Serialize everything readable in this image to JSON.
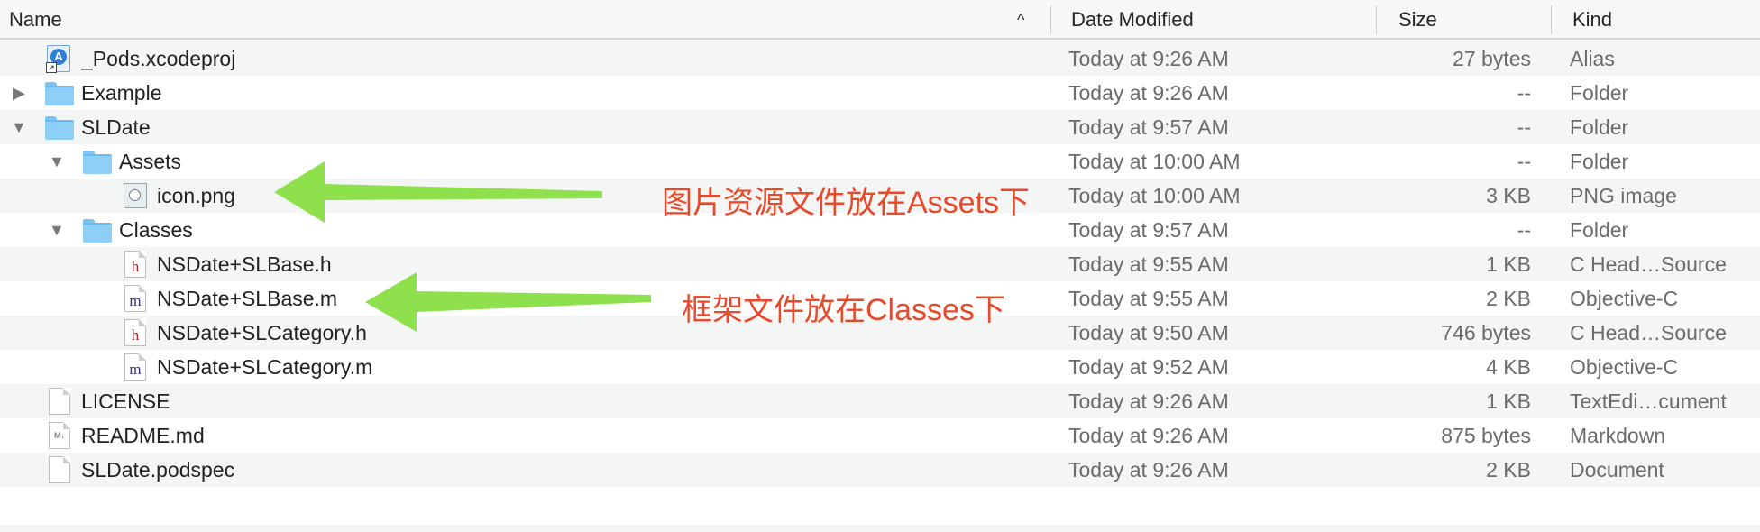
{
  "columns": {
    "name": "Name",
    "date": "Date Modified",
    "size": "Size",
    "kind": "Kind"
  },
  "sort_indicator": "^",
  "rows": [
    {
      "name": "_Pods.xcodeproj",
      "date": "Today at 9:26 AM",
      "size": "27 bytes",
      "kind": "Alias",
      "icon": "xcodeproj-alias-icon",
      "disclosure": ""
    },
    {
      "name": "Example",
      "date": "Today at 9:26 AM",
      "size": "--",
      "kind": "Folder",
      "icon": "folder-icon",
      "disclosure": "▶"
    },
    {
      "name": "SLDate",
      "date": "Today at 9:57 AM",
      "size": "--",
      "kind": "Folder",
      "icon": "folder-icon",
      "disclosure": "▼"
    },
    {
      "name": "Assets",
      "date": "Today at 10:00 AM",
      "size": "--",
      "kind": "Folder",
      "icon": "folder-icon",
      "disclosure": "▼"
    },
    {
      "name": "icon.png",
      "date": "Today at 10:00 AM",
      "size": "3 KB",
      "kind": "PNG image",
      "icon": "png-image-icon",
      "disclosure": ""
    },
    {
      "name": "Classes",
      "date": "Today at 9:57 AM",
      "size": "--",
      "kind": "Folder",
      "icon": "folder-icon",
      "disclosure": "▼"
    },
    {
      "name": "NSDate+SLBase.h",
      "date": "Today at 9:55 AM",
      "size": "1 KB",
      "kind": "C Head…Source",
      "icon": "header-file-icon",
      "glyph": "h",
      "disclosure": ""
    },
    {
      "name": "NSDate+SLBase.m",
      "date": "Today at 9:55 AM",
      "size": "2 KB",
      "kind": "Objective-C",
      "icon": "objc-file-icon",
      "glyph": "m",
      "disclosure": ""
    },
    {
      "name": "NSDate+SLCategory.h",
      "date": "Today at 9:50 AM",
      "size": "746 bytes",
      "kind": "C Head…Source",
      "icon": "header-file-icon",
      "glyph": "h",
      "disclosure": ""
    },
    {
      "name": "NSDate+SLCategory.m",
      "date": "Today at 9:52 AM",
      "size": "4 KB",
      "kind": "Objective-C",
      "icon": "objc-file-icon",
      "glyph": "m",
      "disclosure": ""
    },
    {
      "name": "LICENSE",
      "date": "Today at 9:26 AM",
      "size": "1 KB",
      "kind": "TextEdi…cument",
      "icon": "text-document-icon",
      "disclosure": ""
    },
    {
      "name": "README.md",
      "date": "Today at 9:26 AM",
      "size": "875 bytes",
      "kind": "Markdown",
      "icon": "markdown-file-icon",
      "glyph": "M↓",
      "disclosure": ""
    },
    {
      "name": "SLDate.podspec",
      "date": "Today at 9:26 AM",
      "size": "2 KB",
      "kind": "Document",
      "icon": "document-icon",
      "disclosure": ""
    }
  ],
  "annotations": {
    "assets_note": "图片资源文件放在Assets下",
    "classes_note": "框架文件放在Classes下",
    "arrow_color": "#8ee04c",
    "text_color": "#e64a2a"
  },
  "colors": {
    "folder": "#8ecff8",
    "row_alt": "#f4f5f5",
    "header_bg": "#f7f7f7",
    "h_glyph": "#b22222",
    "m_glyph": "#3a2e8a"
  }
}
